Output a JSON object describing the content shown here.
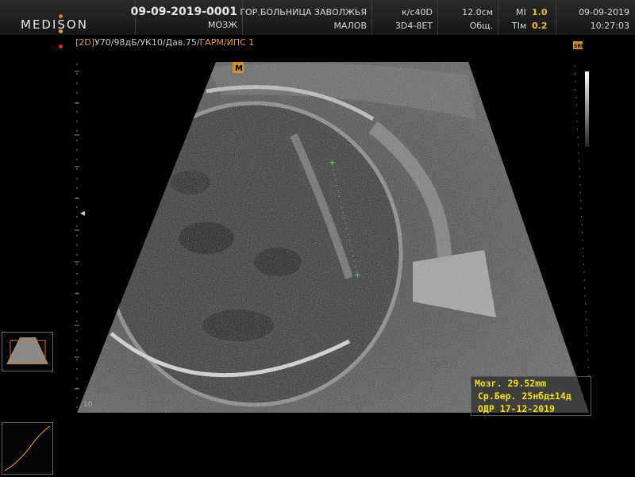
{
  "header": {
    "brand": "MEDISON",
    "patient_id": "09-09-2019-0001",
    "exam": "МОЗЖ",
    "hospital": "ГОР.БОЛЬНИЦА ЗАВОЛЖЬЯ",
    "doctor": "МАЛОВ",
    "frequency": "к/с40D",
    "probe": "3D4-8ET",
    "depth": "12.0см",
    "preset": "Общ.",
    "mi_label": "MI",
    "mi_value": "1.0",
    "tim_label": "TIм",
    "tim_value": "0.2",
    "date": "09-09-2019",
    "time": "10:27:03",
    "accent_orange": "#e8a020",
    "dot_colors": [
      "#f07020",
      "#f0a020",
      "#e03020"
    ]
  },
  "params": {
    "mode": "[2D]",
    "settings": "У70/98дБ/УК10/Дав.75/",
    "harmonic": "ГАРМ/ИПС 1"
  },
  "scan": {
    "focus_marker": "◂",
    "depth_bottom": "10",
    "orientation_marker": "M",
    "srf_badge": "SRF"
  },
  "measurement": {
    "line1": "Мозг. 29.52mm",
    "line2": "Ср.Бер. 25нбд±14д",
    "line3": "ОДР 17-12-2019",
    "color": "#f2e012"
  }
}
